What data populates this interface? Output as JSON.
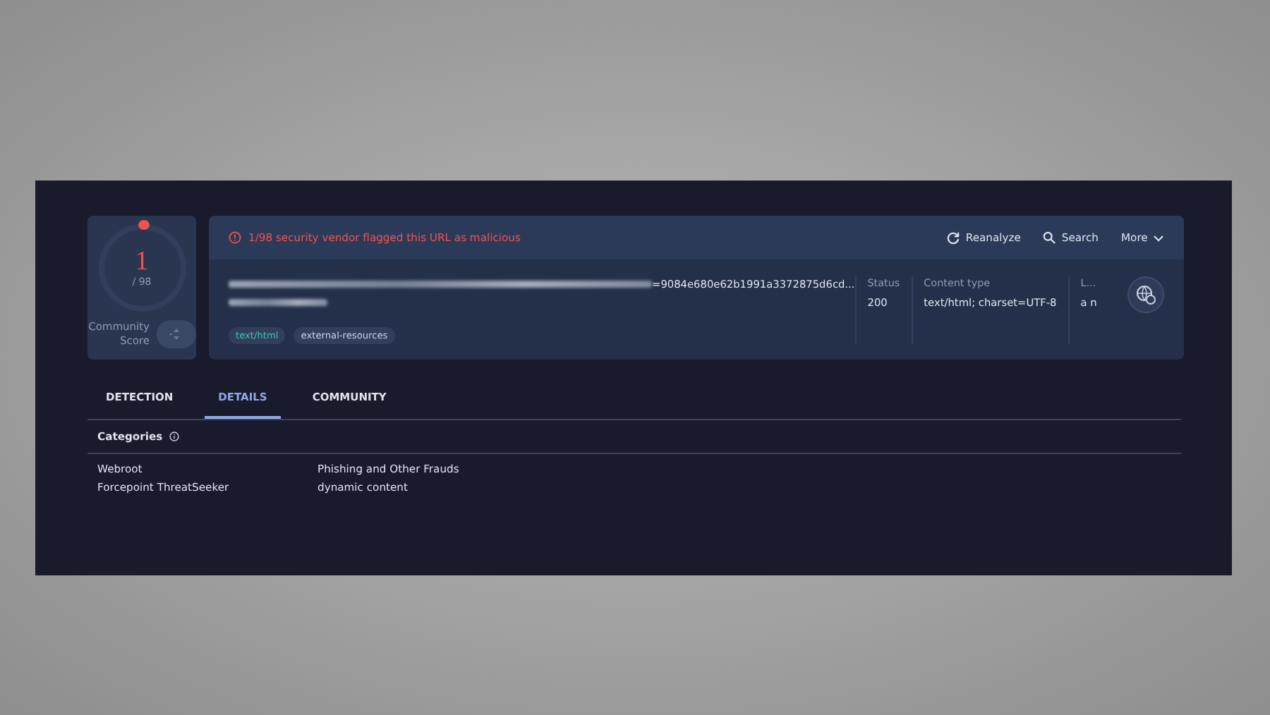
{
  "score": {
    "detections": "1",
    "total": "/ 98",
    "community_label": "Community Score"
  },
  "alert": "1/98 security vendor flagged this URL as malicious",
  "actions": [
    {
      "kind": "reanalyze",
      "label": "Reanalyze"
    },
    {
      "kind": "search",
      "label": "Search"
    },
    {
      "kind": "more",
      "label": "More"
    }
  ],
  "url": {
    "visible_end": "=9084e680e62b1991a3372875d6cd..."
  },
  "tags": [
    {
      "label": "text/html",
      "color": "#3ec7a0"
    },
    {
      "label": "external-resources",
      "color": "#c9d1e0"
    }
  ],
  "meta": [
    {
      "label": "Status",
      "value": "200"
    },
    {
      "label": "Content type",
      "value": "text/html; charset=UTF-8"
    },
    {
      "label": "L...",
      "value": "a n"
    }
  ],
  "tabs": [
    {
      "label": "DETECTION",
      "selected": false
    },
    {
      "label": "DETAILS",
      "selected": true
    },
    {
      "label": "COMMUNITY",
      "selected": false
    }
  ],
  "categories": {
    "title": "Categories",
    "rows": [
      {
        "vendor": "Webroot",
        "category": "Phishing and Other Frauds"
      },
      {
        "vendor": "Forcepoint ThreatSeeker",
        "category": "dynamic content"
      }
    ]
  }
}
